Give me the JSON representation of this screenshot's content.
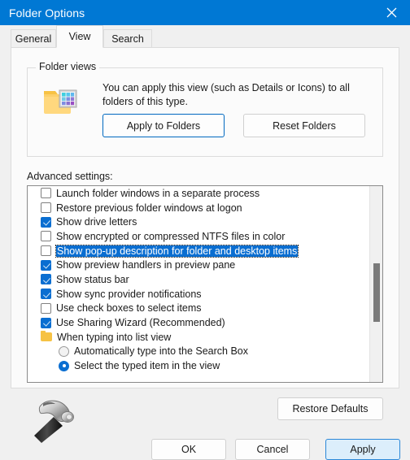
{
  "window": {
    "title": "Folder Options",
    "titlebar_color": "#0078d4",
    "close_icon": "close-icon"
  },
  "tabs": [
    {
      "label": "General",
      "active": false
    },
    {
      "label": "View",
      "active": true
    },
    {
      "label": "Search",
      "active": false
    }
  ],
  "folder_views": {
    "legend": "Folder views",
    "icon": "folder-view-icon",
    "description": "You can apply this view (such as Details or Icons) to all folders of this type.",
    "apply_to_folders_label": "Apply to Folders",
    "reset_folders_label": "Reset Folders"
  },
  "advanced": {
    "label": "Advanced settings:",
    "items": [
      {
        "type": "checkbox",
        "checked": false,
        "selected": false,
        "label": "Launch folder windows in a separate process"
      },
      {
        "type": "checkbox",
        "checked": false,
        "selected": false,
        "label": "Restore previous folder windows at logon"
      },
      {
        "type": "checkbox",
        "checked": true,
        "selected": false,
        "label": "Show drive letters"
      },
      {
        "type": "checkbox",
        "checked": false,
        "selected": false,
        "label": "Show encrypted or compressed NTFS files in color"
      },
      {
        "type": "checkbox",
        "checked": false,
        "selected": true,
        "label": "Show pop-up description for folder and desktop items"
      },
      {
        "type": "checkbox",
        "checked": true,
        "selected": false,
        "label": "Show preview handlers in preview pane"
      },
      {
        "type": "checkbox",
        "checked": true,
        "selected": false,
        "label": "Show status bar"
      },
      {
        "type": "checkbox",
        "checked": true,
        "selected": false,
        "label": "Show sync provider notifications"
      },
      {
        "type": "checkbox",
        "checked": false,
        "selected": false,
        "label": "Use check boxes to select items"
      },
      {
        "type": "checkbox",
        "checked": true,
        "selected": false,
        "label": "Use Sharing Wizard (Recommended)"
      },
      {
        "type": "folder",
        "checked": false,
        "selected": false,
        "label": "When typing into list view"
      },
      {
        "type": "radio",
        "checked": false,
        "selected": false,
        "indent": true,
        "label": "Automatically type into the Search Box"
      },
      {
        "type": "radio",
        "checked": true,
        "selected": false,
        "indent": true,
        "label": "Select the typed item in the view"
      }
    ],
    "selection_color": "#0a6ed1",
    "check_color": "#0a6ed1"
  },
  "buttons": {
    "restore_defaults": "Restore Defaults",
    "ok": "OK",
    "cancel": "Cancel",
    "apply": "Apply"
  },
  "cursor": {
    "icon": "hammer-cursor-icon"
  }
}
